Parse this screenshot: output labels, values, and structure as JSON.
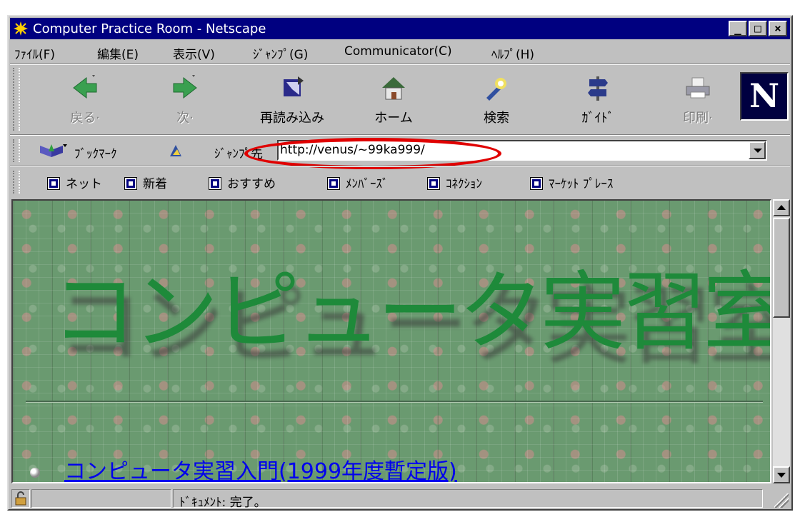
{
  "window": {
    "title": "Computer Practice Room - Netscape",
    "controls": {
      "minimize": "_",
      "maximize": "□",
      "close": "×"
    }
  },
  "menu": [
    "ﾌｧｲﾙ(F)",
    "編集(E)",
    "表示(V)",
    "ｼﾞｬﾝﾌﾟ(G)",
    "Communicator(C)",
    "ﾍﾙﾌﾟ(H)"
  ],
  "toolbar": {
    "back": "戻る·",
    "forward": "次·",
    "reload": "再読み込み",
    "home": "ホーム",
    "search": "検索",
    "guide": "ｶﾞｲﾄﾞ",
    "print": "印刷·",
    "logo": "N"
  },
  "location": {
    "bookmarks_label": "ﾌﾞｯｸﾏｰｸ",
    "jump_label": "ｼﾞｬﾝﾌﾟ先",
    "url": "http://venus/~99ka999/"
  },
  "personal_toolbar": [
    "ネット",
    "新着",
    "おすすめ",
    "ﾒﾝﾊﾞｰｽﾞ",
    "ｺﾈｸｼｮﾝ",
    "ﾏｰｹｯﾄ ﾌﾟﾚｰｽ"
  ],
  "page": {
    "headline": "コンピュータ実習室",
    "link_text": "コンピュータ実習入門(1999年度暫定版)"
  },
  "status": {
    "text": "ﾄﾞｷｭﾒﾝﾄ: 完了。"
  },
  "colors": {
    "titlebar": "#000080",
    "headline": "#1e8a3a",
    "highlight_oval": "#e00000",
    "link": "#0000ee"
  }
}
